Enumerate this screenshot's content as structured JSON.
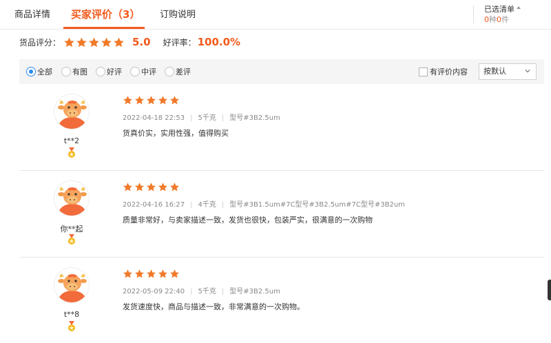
{
  "tabs": [
    {
      "label": "商品详情"
    },
    {
      "label": "买家评价（3）"
    },
    {
      "label": "订购说明"
    }
  ],
  "cart": {
    "title": "已选清单",
    "kinds": "0",
    "kinds_unit": "种",
    "items": "0",
    "items_unit": "件"
  },
  "summary": {
    "rating_label": "货品评分：",
    "rating_stars": 5,
    "rating_value": "5.0",
    "good_rate_label": "好评率：",
    "good_rate_value": "100.0%"
  },
  "filter": {
    "options": [
      {
        "label": "全部",
        "checked": true
      },
      {
        "label": "有图",
        "checked": false
      },
      {
        "label": "好评",
        "checked": false
      },
      {
        "label": "中评",
        "checked": false
      },
      {
        "label": "差评",
        "checked": false
      }
    ],
    "has_content_label": "有评价内容",
    "sort_value": "按默认"
  },
  "reviews": [
    {
      "nickname": "t**2",
      "stars": 5,
      "datetime": "2022-04-18 22:53",
      "weight": "5千克",
      "spec": "型号#3B2.5um",
      "content": "货真价实，实用性强，值得购买"
    },
    {
      "nickname": "你**起",
      "stars": 5,
      "datetime": "2022-04-16 16:27",
      "weight": "4千克",
      "spec": "型号#3B1.5um#7C型号#3B2.5um#7C型号#3B2um",
      "content": "质量非常好，与卖家描述一致，发货也很快，包装严实，很满意的一次购物"
    },
    {
      "nickname": "t**8",
      "stars": 5,
      "datetime": "2022-05-09 22:40",
      "weight": "5千克",
      "spec": "型号#3B2.5um",
      "content": "发货速度快，商品与描述一致，非常满意的一次购物。"
    }
  ],
  "colors": {
    "accent": "#f35a1b",
    "star": "#f07a2a",
    "radio": "#2d8cf0"
  }
}
